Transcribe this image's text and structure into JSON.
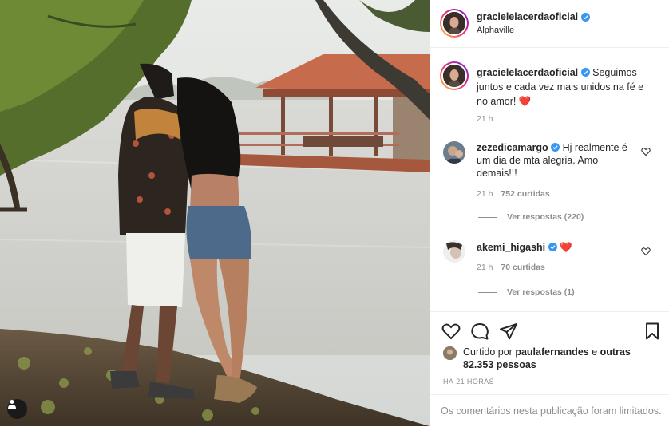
{
  "post": {
    "author": "gracielelacerdaoficial",
    "location": "Alphaville",
    "caption": {
      "username": "gracielelacerdaoficial",
      "text": "Seguimos juntos e cada vez mais unidos na fé e no amor!",
      "emoji": "❤️",
      "time": "21 h"
    },
    "comments": [
      {
        "username": "zezedicamargo",
        "text": "Hj realmente é um dia de mta alegria. Amo demais!!!",
        "time": "21 h",
        "likes": "752 curtidas",
        "replies": "Ver respostas (220)"
      },
      {
        "username": "akemi_higashi",
        "text": "",
        "emoji": "❤️",
        "time": "21 h",
        "likes": "70 curtidas",
        "replies": "Ver respostas (1)"
      }
    ],
    "liked_by": {
      "prefix": "Curtido por",
      "user": "paulafernandes",
      "connector": "e",
      "others": "outras 82.353 pessoas"
    },
    "timestamp": "HÁ 21 HORAS",
    "comments_limited": "Os comentários nesta publicação foram limitados."
  },
  "icons": {
    "verified": "verified-badge-icon",
    "like": "heart-icon",
    "comment": "comment-bubble-icon",
    "share": "paper-plane-icon",
    "save": "bookmark-icon",
    "user_tag": "user-tag-icon"
  },
  "colors": {
    "verified_blue": "#3897f0",
    "heart_red": "#ed4956",
    "muted_text": "#8e8e8e",
    "border": "#dbdbdb"
  }
}
